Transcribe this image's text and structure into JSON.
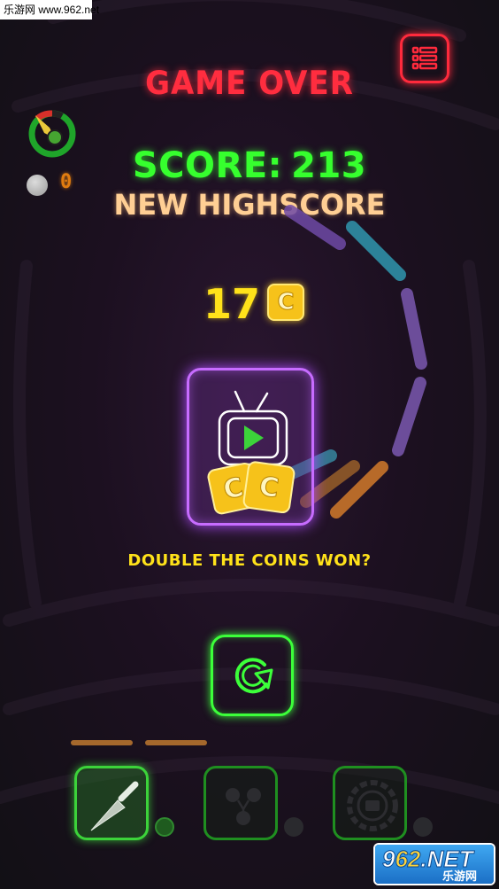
{
  "watermark_top": "乐游网 www.962.net",
  "header": {
    "title": "GAME OVER",
    "menu_icon": "list-icon",
    "menu_color": "#ff2a3c"
  },
  "hud": {
    "gauge_icon": "speed-gauge-icon",
    "coin_count": "0"
  },
  "results": {
    "score_label": "SCORE:",
    "score_value": "213",
    "highscore_text": "NEW HIGHSCORE",
    "coins_won": "17",
    "coin_symbol": "C"
  },
  "ad_offer": {
    "icon": "tv-play-icon",
    "question": "DOUBLE THE COINS WON?",
    "border_color": "#c76cff"
  },
  "replay": {
    "icon": "replay-icon",
    "color": "#3cff3a"
  },
  "slots": [
    {
      "icon": "knife-icon",
      "active": true
    },
    {
      "icon": "split-circles-icon",
      "active": false
    },
    {
      "icon": "gear-wheel-icon",
      "active": false
    }
  ],
  "watermark_bottom": {
    "brand_prefix": "9",
    "brand_highlight": "62",
    "brand_suffix": ".NET",
    "sub": "乐游网"
  }
}
